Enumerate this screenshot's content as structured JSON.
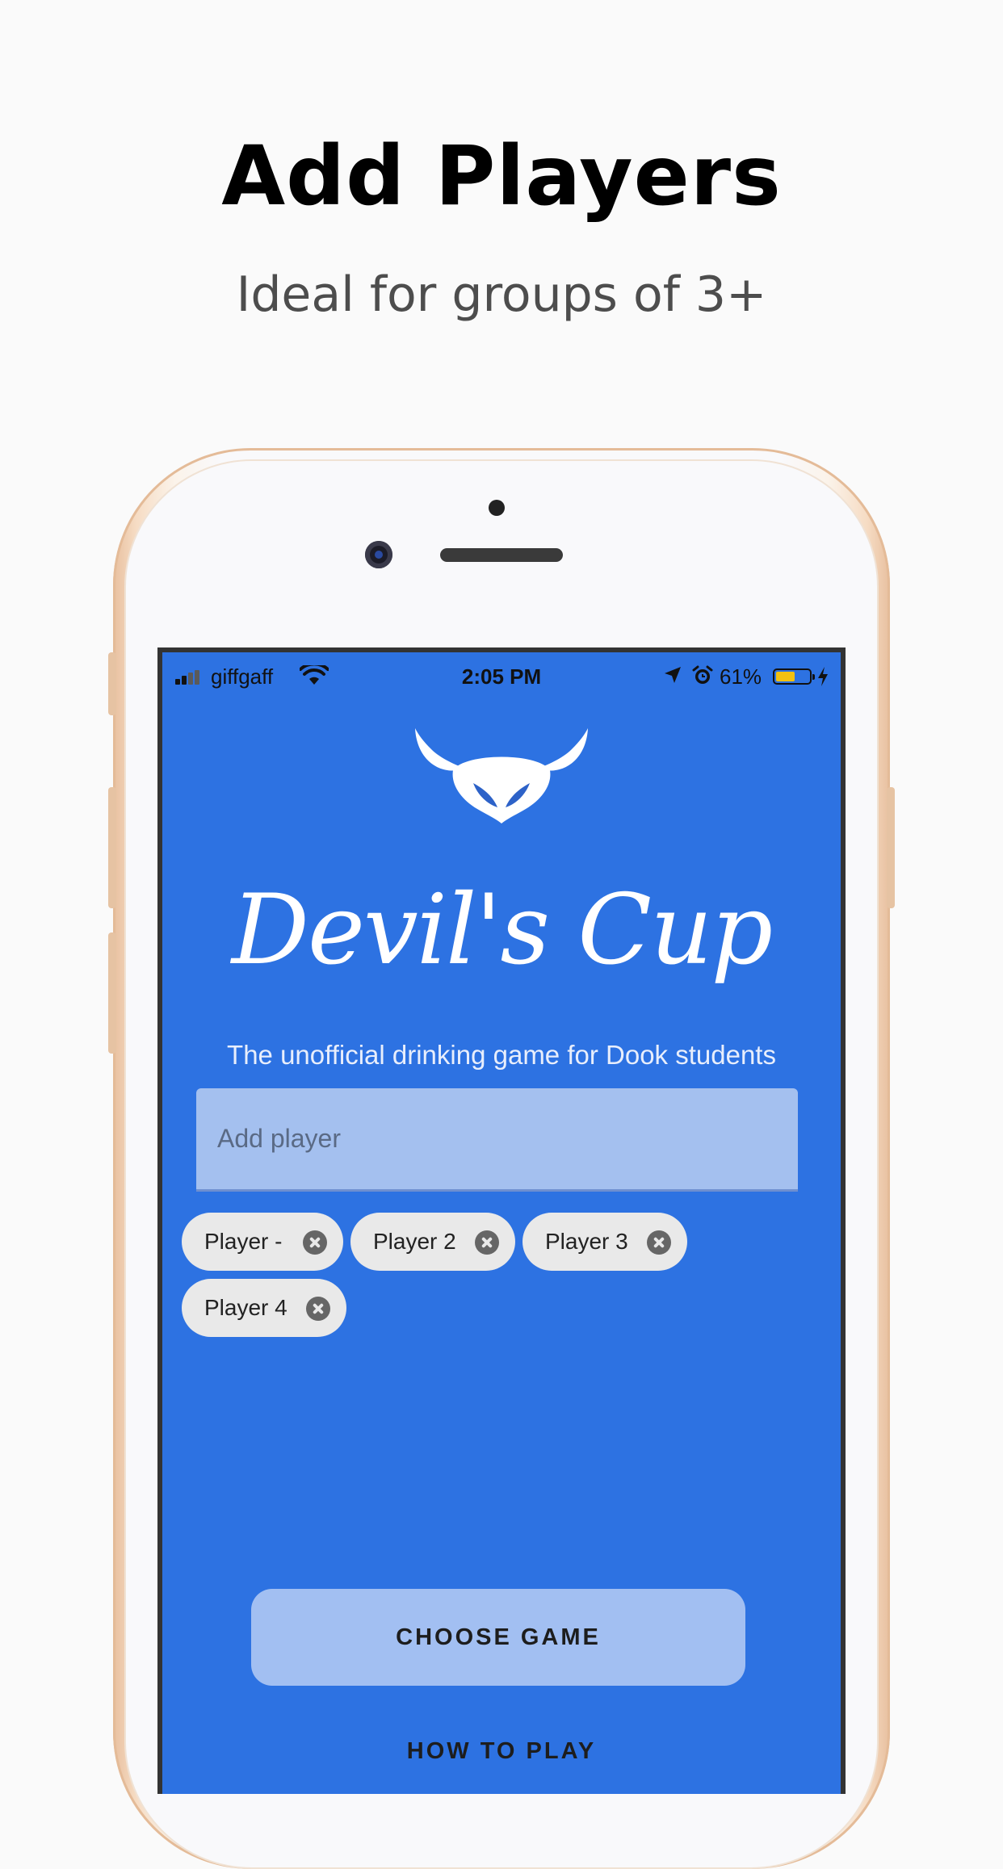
{
  "promo": {
    "headline": "Add Players",
    "subheadline": "Ideal for groups of 3+"
  },
  "status_bar": {
    "carrier": "giffgaff",
    "time": "2:05 PM",
    "battery_percent": "61%",
    "battery_level": 0.61,
    "icons": [
      "signal-icon",
      "wifi-icon",
      "location-icon",
      "alarm-icon",
      "battery-icon",
      "charging-icon"
    ]
  },
  "app": {
    "logo_icon": "devil-horns-logo",
    "title": "Devil's Cup",
    "tagline": "The unofficial drinking game for Dook students",
    "add_player_placeholder": "Add player",
    "players": [
      {
        "label": "Player -"
      },
      {
        "label": "Player 2"
      },
      {
        "label": "Player 3"
      },
      {
        "label": "Player 4"
      }
    ],
    "choose_game_label": "CHOOSE GAME",
    "how_to_play_label": "HOW TO PLAY"
  },
  "colors": {
    "screen_bg": "#2d72e2",
    "input_bg": "#a4c0ef",
    "chip_bg": "#e9e9e9",
    "button_bg": "#a2bff2",
    "phone_frame": "#e8c09f"
  }
}
